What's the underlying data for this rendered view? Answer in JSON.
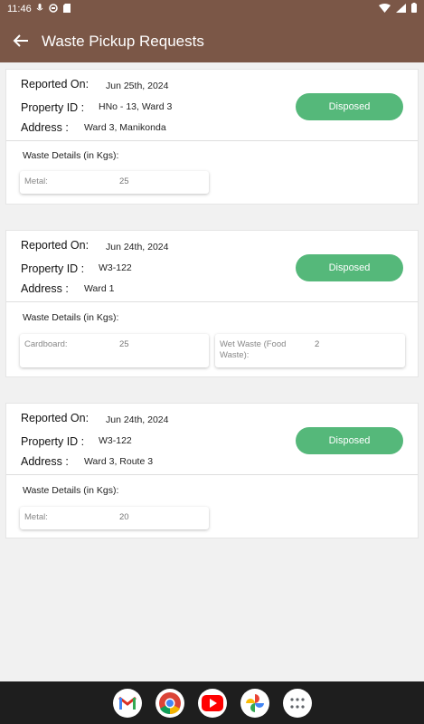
{
  "status_bar": {
    "time": "11:46"
  },
  "app_bar": {
    "title": "Waste Pickup Requests"
  },
  "labels": {
    "reported_on": "Reported On:",
    "property_id": "Property ID :",
    "address": "Address :",
    "waste_details": "Waste Details (in Kgs):"
  },
  "requests": [
    {
      "reported_on": "Jun 25th, 2024",
      "property_id": "HNo - 13, Ward 3",
      "address": "Ward 3, Manikonda",
      "status": "Disposed",
      "waste": [
        {
          "name": "Metal:",
          "qty": "25"
        }
      ]
    },
    {
      "reported_on": "Jun 24th, 2024",
      "property_id": "W3-122",
      "address": "Ward 1",
      "status": "Disposed",
      "waste": [
        {
          "name": "Cardboard:",
          "qty": "25"
        },
        {
          "name": "Wet Waste (Food Waste):",
          "qty": "2"
        }
      ]
    },
    {
      "reported_on": "Jun 24th, 2024",
      "property_id": "W3-122",
      "address": "Ward 3, Route 3",
      "status": "Disposed",
      "waste": [
        {
          "name": "Metal:",
          "qty": "20"
        }
      ]
    }
  ],
  "dock": [
    "gmail-icon",
    "chrome-icon",
    "youtube-icon",
    "photos-icon",
    "app-drawer-icon"
  ],
  "colors": {
    "app_bar": "#7b5747",
    "status_pill": "#55b87a",
    "nav_bar": "#1e1e1e"
  }
}
